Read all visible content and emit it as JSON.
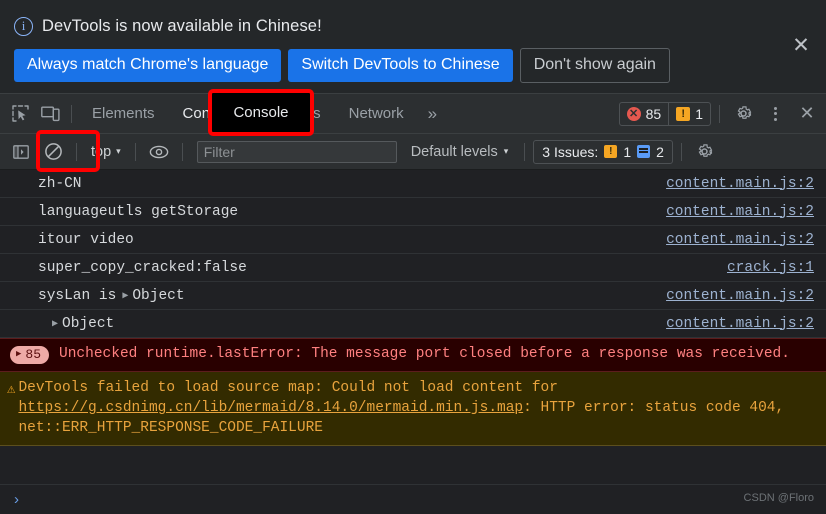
{
  "infobar": {
    "icon": "info-circle-icon",
    "message": "DevTools is now available in Chinese!",
    "buttons": [
      {
        "label": "Always match Chrome's language",
        "style": "primary"
      },
      {
        "label": "Switch DevTools to Chinese",
        "style": "primary"
      },
      {
        "label": "Don't show again",
        "style": "ghost"
      }
    ],
    "close_label": "✕"
  },
  "main_toolbar": {
    "inspect_icon": "inspect-element-icon",
    "device_icon": "device-toolbar-icon",
    "tabs": [
      {
        "label": "Elements",
        "active": false
      },
      {
        "label": "Console",
        "active": true
      },
      {
        "label": "Sources",
        "active": false
      },
      {
        "label": "Network",
        "active": false
      }
    ],
    "more_tabs_label": "»",
    "error_count": "85",
    "warning_count": "1",
    "error_glyph": "✕",
    "warning_glyph": "!",
    "settings_icon": "gear-icon",
    "more_icon": "kebab-menu-icon",
    "close_label": "✕"
  },
  "console_toolbar": {
    "sidebar_toggle_icon": "console-sidebar-icon",
    "clear_icon": "clear-console-icon",
    "context": "top",
    "context_caret": "▾",
    "eye_icon": "live-expression-icon",
    "filter_value": "",
    "filter_placeholder": "Filter",
    "levels_label": "Default levels",
    "levels_caret": "▾",
    "issues_label": "3 Issues:",
    "issues_warning_count": "1",
    "issues_info_count": "2",
    "issues_warning_glyph": "!",
    "settings_icon": "gear-icon"
  },
  "logs": [
    {
      "text": "zh-CN",
      "object": "",
      "source": "content.main.js:2",
      "indent": false
    },
    {
      "text": "languageutls getStorage",
      "object": "",
      "source": "content.main.js:2",
      "indent": false
    },
    {
      "text": "itour video",
      "object": "",
      "source": "content.main.js:2",
      "indent": false
    },
    {
      "text": "super_copy_cracked:false",
      "object": "",
      "source": "crack.js:1",
      "indent": false
    },
    {
      "text": "sysLan is",
      "object": "Object",
      "source": "content.main.js:2",
      "indent": false
    },
    {
      "text": "",
      "object": "Object",
      "source": "content.main.js:2",
      "indent": true
    }
  ],
  "error_message": {
    "count": "85",
    "triangle": "▶",
    "text": "Unchecked runtime.lastError: The message port closed before a response was received."
  },
  "warning_message": {
    "icon": "warning-triangle-icon",
    "glyph": "⚠",
    "part1": "DevTools failed to load source map: Could not load content for ",
    "link": "https://g.csdnimg.cn/lib/mermaid/8.14.0/mermaid.min.js.map",
    "part2": ": HTTP error: status code 404, net::ERR_HTTP_RESPONSE_CODE_FAILURE"
  },
  "prompt": {
    "caret": "›"
  },
  "watermark": "CSDN @Floro",
  "annotations": {
    "console_tab_label": "Console",
    "accent_red": "#ff0000"
  }
}
